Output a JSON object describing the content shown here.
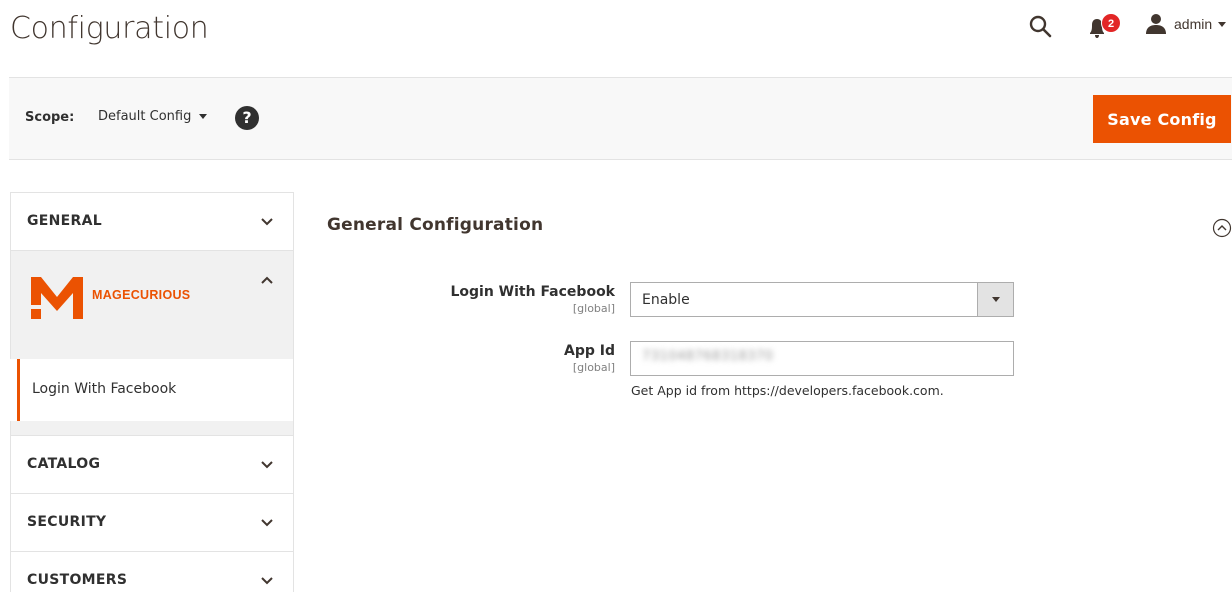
{
  "header": {
    "title": "Configuration",
    "notifications_count": "2",
    "user_name": "admin"
  },
  "scope_bar": {
    "scope_label": "Scope:",
    "scope_value": "Default Config",
    "help_symbol": "?",
    "save_label": "Save Config"
  },
  "sidebar": {
    "tabs": [
      {
        "label": "GENERAL",
        "expanded": false
      },
      {
        "label": "MAGECURIOUS",
        "expanded": true,
        "items": [
          {
            "label": "Login With Facebook",
            "active": true
          }
        ]
      },
      {
        "label": "CATALOG",
        "expanded": false
      },
      {
        "label": "SECURITY",
        "expanded": false
      },
      {
        "label": "CUSTOMERS",
        "expanded": false
      }
    ]
  },
  "main": {
    "section_title": "General Configuration",
    "fields": [
      {
        "label": "Login With Facebook",
        "scope": "[global]",
        "value": "Enable"
      },
      {
        "label": "App Id",
        "scope": "[global]",
        "value": "731048768318370",
        "note": "Get App id from https://developers.facebook.com."
      }
    ]
  },
  "colors": {
    "accent": "#eb5202",
    "badge": "#e22626",
    "text": "#303030"
  },
  "icons": [
    "search-icon",
    "bell-icon",
    "user-icon",
    "help-icon",
    "chevron-down-icon",
    "chevron-up-icon",
    "collapse-circle-icon",
    "magecurious-logo"
  ]
}
